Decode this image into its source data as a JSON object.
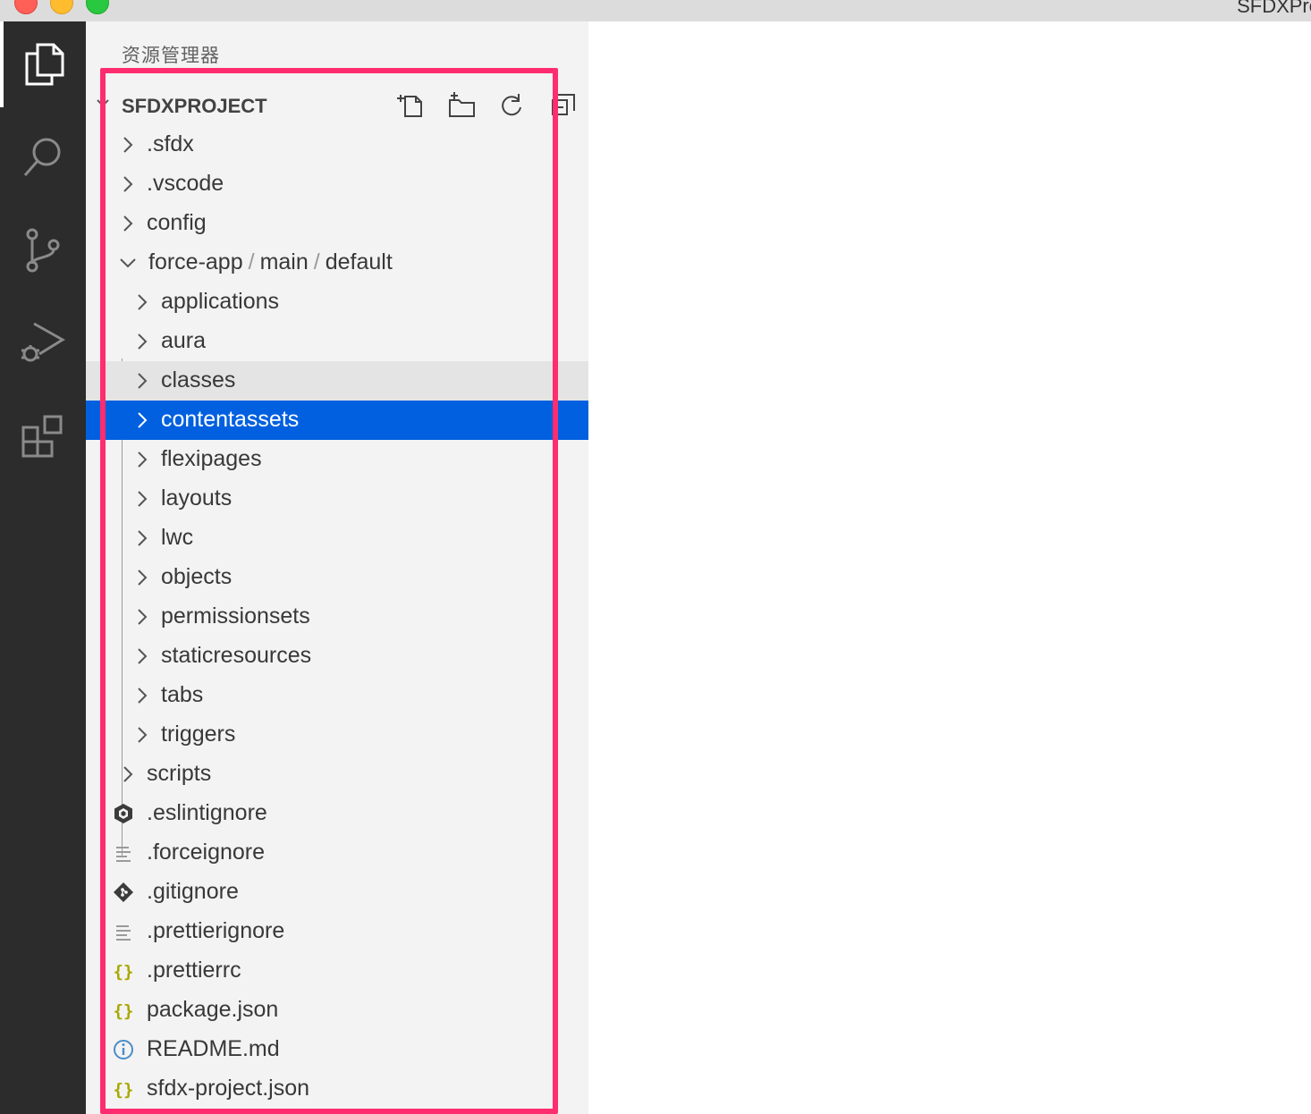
{
  "window": {
    "title": "SFDXPro"
  },
  "activity_bar": {
    "items": [
      {
        "name": "explorer",
        "icon": "files-icon",
        "active": true
      },
      {
        "name": "search",
        "icon": "search-icon",
        "active": false
      },
      {
        "name": "source-control",
        "icon": "source-control-icon",
        "active": false
      },
      {
        "name": "run-debug",
        "icon": "run-debug-icon",
        "active": false
      },
      {
        "name": "extensions",
        "icon": "extensions-icon",
        "active": false
      }
    ]
  },
  "sidebar": {
    "title": "资源管理器",
    "section": {
      "name": "SFDXPROJECT",
      "actions": [
        "new-file-icon",
        "new-folder-icon",
        "refresh-icon",
        "collapse-all-icon"
      ]
    },
    "tree": [
      {
        "label": ".sfdx",
        "kind": "folder",
        "depth": 0
      },
      {
        "label": ".vscode",
        "kind": "folder",
        "depth": 0
      },
      {
        "label": "config",
        "kind": "folder",
        "depth": 0
      },
      {
        "kind": "folder-open",
        "depth": 0,
        "path": [
          "force-app",
          "main",
          "default"
        ],
        "path_separator": "/"
      },
      {
        "label": "applications",
        "kind": "folder",
        "depth": 1
      },
      {
        "label": "aura",
        "kind": "folder",
        "depth": 1
      },
      {
        "label": "classes",
        "kind": "folder",
        "depth": 1,
        "state": "hover"
      },
      {
        "label": "contentassets",
        "kind": "folder",
        "depth": 1,
        "state": "selected"
      },
      {
        "label": "flexipages",
        "kind": "folder",
        "depth": 1
      },
      {
        "label": "layouts",
        "kind": "folder",
        "depth": 1
      },
      {
        "label": "lwc",
        "kind": "folder",
        "depth": 1
      },
      {
        "label": "objects",
        "kind": "folder",
        "depth": 1
      },
      {
        "label": "permissionsets",
        "kind": "folder",
        "depth": 1
      },
      {
        "label": "staticresources",
        "kind": "folder",
        "depth": 1
      },
      {
        "label": "tabs",
        "kind": "folder",
        "depth": 1
      },
      {
        "label": "triggers",
        "kind": "folder",
        "depth": 1
      },
      {
        "label": "scripts",
        "kind": "folder",
        "depth": 0
      },
      {
        "label": ".eslintignore",
        "kind": "file",
        "depth": 0,
        "icon": "eslint-icon"
      },
      {
        "label": ".forceignore",
        "kind": "file",
        "depth": 0,
        "icon": "text-file-icon"
      },
      {
        "label": ".gitignore",
        "kind": "file",
        "depth": 0,
        "icon": "git-icon"
      },
      {
        "label": ".prettierignore",
        "kind": "file",
        "depth": 0,
        "icon": "text-file-icon"
      },
      {
        "label": ".prettierrc",
        "kind": "file",
        "depth": 0,
        "icon": "json-icon"
      },
      {
        "label": "package.json",
        "kind": "file",
        "depth": 0,
        "icon": "json-icon"
      },
      {
        "label": "README.md",
        "kind": "file",
        "depth": 0,
        "icon": "info-icon"
      },
      {
        "label": "sfdx-project.json",
        "kind": "file",
        "depth": 0,
        "icon": "json-icon"
      }
    ]
  },
  "colors": {
    "activity_bar": "#2c2c2c",
    "sidebar": "#f3f3f3",
    "selection": "#0060df",
    "hover": "#e4e4e4",
    "annotation_box": "#ff2d6f",
    "json_icon": "#a8a800",
    "info_icon": "#4a8cc7"
  }
}
